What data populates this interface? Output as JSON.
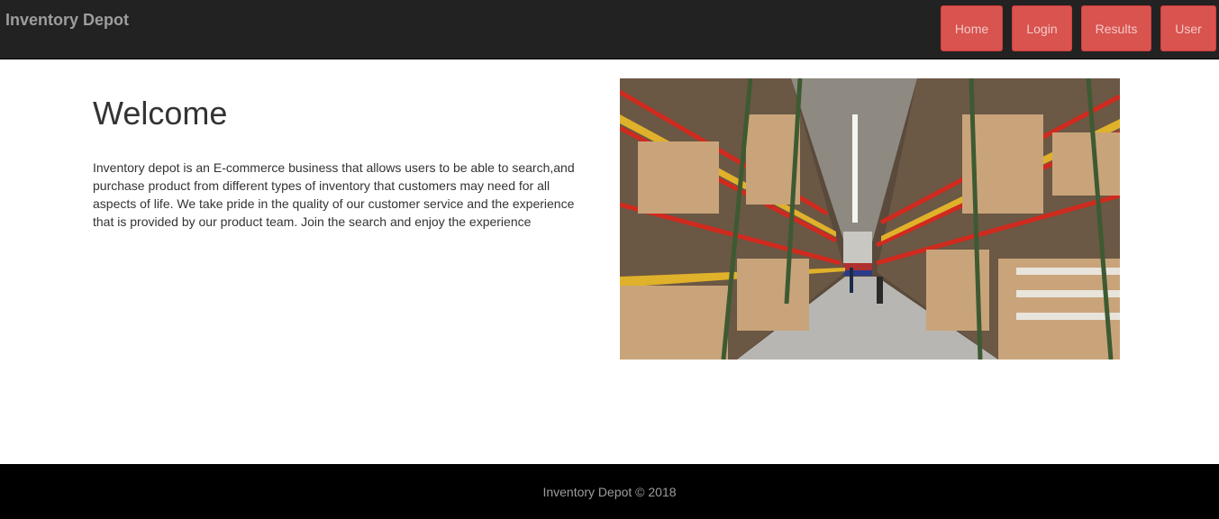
{
  "brand": "Inventory Depot",
  "nav": {
    "home": "Home",
    "login": "Login",
    "results": "Results",
    "user": "User"
  },
  "main": {
    "heading": "Welcome",
    "intro": "Inventory depot is an E-commerce business that allows users to be able to search,and purchase product from different types of inventory that customers may need for all aspects of life. We take pride in the quality of our customer service and the experience that is provided by our product team. Join the search and enjoy the experience"
  },
  "footer": "Inventory Depot © 2018",
  "colors": {
    "navbar": "#222222",
    "button": "#d9534f",
    "footer": "#000000"
  }
}
